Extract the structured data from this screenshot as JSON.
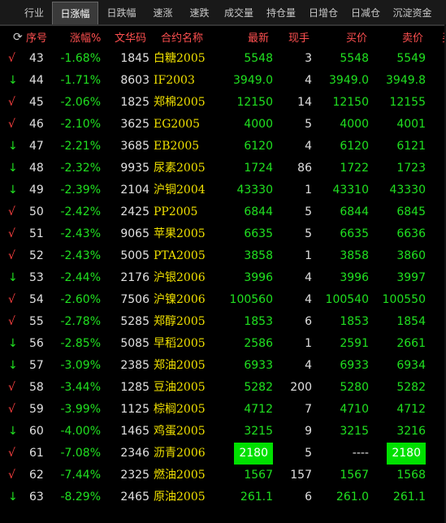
{
  "tabs": [
    {
      "label": "行业",
      "active": false
    },
    {
      "label": "日涨幅",
      "active": true
    },
    {
      "label": "日跌幅",
      "active": false
    },
    {
      "label": "速涨",
      "active": false
    },
    {
      "label": "速跌",
      "active": false
    },
    {
      "label": "成交量",
      "active": false
    },
    {
      "label": "持仓量",
      "active": false
    },
    {
      "label": "日增仓",
      "active": false
    },
    {
      "label": "日减仓",
      "active": false
    },
    {
      "label": "沉淀资金",
      "active": false
    }
  ],
  "header": {
    "seq": "序号",
    "change": "涨幅%",
    "code": "文华码",
    "name": "合约名称",
    "last": "最新",
    "vol": "现手",
    "bid": "买价",
    "ask": "卖价",
    "more": "买"
  },
  "rows": [
    {
      "dir": "up",
      "seq": "43",
      "chg": "-1.68%",
      "code": "1845",
      "name": "白糖2005",
      "last": "5548",
      "vol": "3",
      "bid": "5548",
      "ask": "5549"
    },
    {
      "dir": "down",
      "seq": "44",
      "chg": "-1.71%",
      "code": "8603",
      "name": "IF2003",
      "last": "3949.0",
      "vol": "4",
      "bid": "3949.0",
      "ask": "3949.8"
    },
    {
      "dir": "up",
      "seq": "45",
      "chg": "-2.06%",
      "code": "1825",
      "name": "郑棉2005",
      "last": "12150",
      "vol": "14",
      "bid": "12150",
      "ask": "12155"
    },
    {
      "dir": "up",
      "seq": "46",
      "chg": "-2.10%",
      "code": "3625",
      "name": "EG2005",
      "last": "4000",
      "vol": "5",
      "bid": "4000",
      "ask": "4001"
    },
    {
      "dir": "down",
      "seq": "47",
      "chg": "-2.21%",
      "code": "3685",
      "name": "EB2005",
      "last": "6120",
      "vol": "4",
      "bid": "6120",
      "ask": "6121"
    },
    {
      "dir": "down",
      "seq": "48",
      "chg": "-2.32%",
      "code": "9935",
      "name": "尿素2005",
      "last": "1724",
      "vol": "86",
      "bid": "1722",
      "ask": "1723"
    },
    {
      "dir": "down",
      "seq": "49",
      "chg": "-2.39%",
      "code": "2104",
      "name": "沪铜2004",
      "last": "43330",
      "vol": "1",
      "bid": "43310",
      "ask": "43330"
    },
    {
      "dir": "up",
      "seq": "50",
      "chg": "-2.42%",
      "code": "2425",
      "name": "PP2005",
      "last": "6844",
      "vol": "5",
      "bid": "6844",
      "ask": "6845"
    },
    {
      "dir": "up",
      "seq": "51",
      "chg": "-2.43%",
      "code": "9065",
      "name": "苹果2005",
      "last": "6635",
      "vol": "5",
      "bid": "6635",
      "ask": "6636"
    },
    {
      "dir": "up",
      "seq": "52",
      "chg": "-2.43%",
      "code": "5005",
      "name": "PTA2005",
      "last": "3858",
      "vol": "1",
      "bid": "3858",
      "ask": "3860"
    },
    {
      "dir": "down",
      "seq": "53",
      "chg": "-2.44%",
      "code": "2176",
      "name": "沪银2006",
      "last": "3996",
      "vol": "4",
      "bid": "3996",
      "ask": "3997"
    },
    {
      "dir": "up",
      "seq": "54",
      "chg": "-2.60%",
      "code": "7506",
      "name": "沪镍2006",
      "last": "100560",
      "vol": "4",
      "bid": "100540",
      "ask": "100550"
    },
    {
      "dir": "up",
      "seq": "55",
      "chg": "-2.78%",
      "code": "5285",
      "name": "郑醇2005",
      "last": "1853",
      "vol": "6",
      "bid": "1853",
      "ask": "1854"
    },
    {
      "dir": "down",
      "seq": "56",
      "chg": "-2.85%",
      "code": "5085",
      "name": "早稻2005",
      "last": "2586",
      "vol": "1",
      "bid": "2591",
      "ask": "2661"
    },
    {
      "dir": "down",
      "seq": "57",
      "chg": "-3.09%",
      "code": "2385",
      "name": "郑油2005",
      "last": "6933",
      "vol": "4",
      "bid": "6933",
      "ask": "6934"
    },
    {
      "dir": "up",
      "seq": "58",
      "chg": "-3.44%",
      "code": "1285",
      "name": "豆油2005",
      "last": "5282",
      "vol": "200",
      "bid": "5280",
      "ask": "5282"
    },
    {
      "dir": "up",
      "seq": "59",
      "chg": "-3.99%",
      "code": "1125",
      "name": "棕榈2005",
      "last": "4712",
      "vol": "7",
      "bid": "4710",
      "ask": "4712"
    },
    {
      "dir": "down",
      "seq": "60",
      "chg": "-4.00%",
      "code": "1465",
      "name": "鸡蛋2005",
      "last": "3215",
      "vol": "9",
      "bid": "3215",
      "ask": "3216"
    },
    {
      "dir": "up",
      "seq": "61",
      "chg": "-7.08%",
      "code": "2346",
      "name": "沥青2006",
      "last": "2180",
      "vol": "5",
      "bid": "----",
      "ask": "2180",
      "hl": true
    },
    {
      "dir": "up",
      "seq": "62",
      "chg": "-7.44%",
      "code": "2325",
      "name": "燃油2005",
      "last": "1567",
      "vol": "157",
      "bid": "1567",
      "ask": "1568"
    },
    {
      "dir": "down",
      "seq": "63",
      "chg": "-8.29%",
      "code": "2465",
      "name": "原油2005",
      "last": "261.1",
      "vol": "6",
      "bid": "261.0",
      "ask": "261.1"
    }
  ],
  "icons": {
    "up": "check-arrow",
    "down": "down-arrow",
    "refresh": "refresh-icon"
  },
  "colors": {
    "down_value": "#20e020",
    "name": "#f0e000",
    "code": "#e0e0e0",
    "header": "#ff5050",
    "highlight": "#00e000"
  }
}
